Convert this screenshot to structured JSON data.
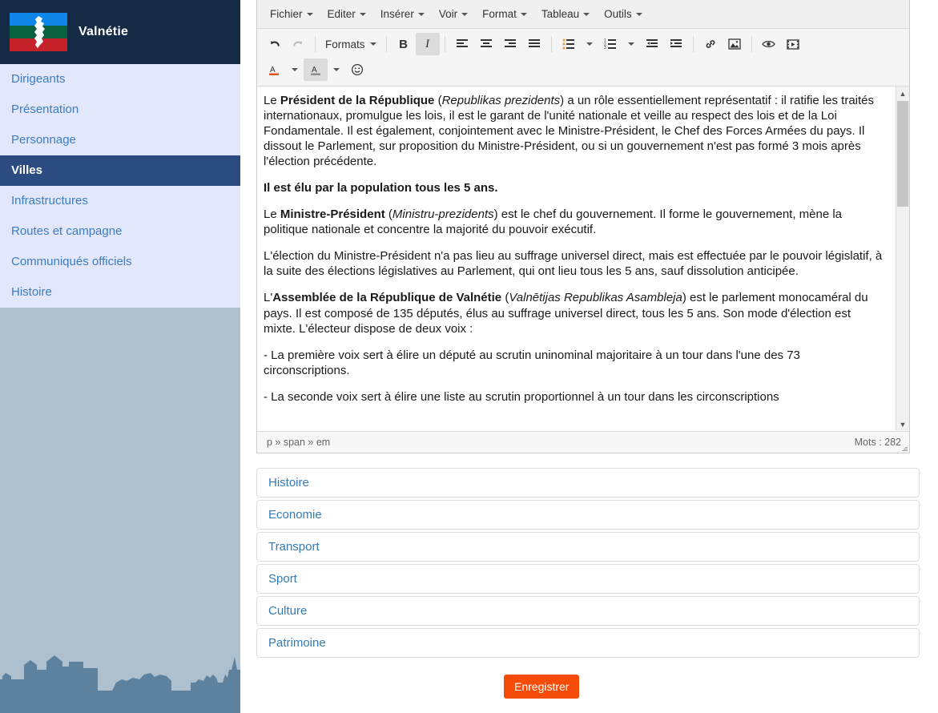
{
  "sidebar": {
    "brand": {
      "title": "Valnétie",
      "logo_icon": "valnetie-flag-icon"
    },
    "items": [
      {
        "label": "Dirigeants",
        "active": false
      },
      {
        "label": "Présentation",
        "active": false
      },
      {
        "label": "Personnage",
        "active": false
      },
      {
        "label": "Villes",
        "active": true
      },
      {
        "label": "Infrastructures",
        "active": false
      },
      {
        "label": "Routes et campagne",
        "active": false
      },
      {
        "label": "Communiqués officiels",
        "active": false
      },
      {
        "label": "Histoire",
        "active": false
      }
    ],
    "footer_graphic": "city-skyline-illustration",
    "colors": {
      "background": "#aec0ce",
      "brand_bg": "#152a45",
      "nav_bg": "#e3e7fb",
      "active_bg": "#2c4c81",
      "link": "#3b7cc4"
    }
  },
  "editor": {
    "menubar": [
      {
        "label": "Fichier"
      },
      {
        "label": "Editer"
      },
      {
        "label": "Insérer"
      },
      {
        "label": "Voir"
      },
      {
        "label": "Format"
      },
      {
        "label": "Tableau"
      },
      {
        "label": "Outils"
      }
    ],
    "toolbar": {
      "undo": "undo-icon",
      "redo": "redo-icon",
      "formats_label": "Formats",
      "bold": "B",
      "italic": "I",
      "align_left": "align-left-icon",
      "align_center": "align-center-icon",
      "align_right": "align-right-icon",
      "align_justify": "align-justify-icon",
      "bullet_list": "bullet-list-icon",
      "numbered_list": "numbered-list-icon",
      "outdent": "outdent-icon",
      "indent": "indent-icon",
      "link": "link-icon",
      "image": "image-icon",
      "preview": "preview-eye-icon",
      "media": "media-icon",
      "text_color": "text-color-icon",
      "background_color": "background-color-icon",
      "emoticon": "emoticon-icon"
    },
    "content": [
      {
        "runs": [
          {
            "t": "Le ",
            "s": ""
          },
          {
            "t": "Président de la République",
            "s": "b"
          },
          {
            "t": " (",
            "s": ""
          },
          {
            "t": "Republikas prezidents",
            "s": "i"
          },
          {
            "t": ") a un rôle essentiellement représentatif : il ratifie les traités internationaux, promulgue les lois, il est le garant de l'unité nationale et veille au respect des lois et de la Loi Fondamentale. Il est également, conjointement avec le Ministre-Président, le Chef des Forces Armées du pays. Il dissout le Parlement, sur proposition du Ministre-Président, ou si un gouvernement n'est pas formé 3 mois après l'élection précédente.",
            "s": ""
          }
        ]
      },
      {
        "runs": [
          {
            "t": "Il est élu par la population tous les 5 ans.",
            "s": "b"
          }
        ]
      },
      {
        "runs": [
          {
            "t": "Le ",
            "s": ""
          },
          {
            "t": "Ministre-Président",
            "s": "b"
          },
          {
            "t": " (",
            "s": ""
          },
          {
            "t": "Ministru-prezidents",
            "s": "i"
          },
          {
            "t": ") est le chef du gouvernement. Il forme le gouvernement, mène la politique nationale et concentre la majorité du pouvoir exécutif.",
            "s": ""
          }
        ]
      },
      {
        "runs": [
          {
            "t": "L'élection du Ministre-Président n'a pas lieu au suffrage universel direct, mais est effectuée par le pouvoir législatif, à la suite des élections législatives au Parlement, qui ont lieu tous les 5 ans, sauf dissolution anticipée.",
            "s": ""
          }
        ]
      },
      {
        "runs": [
          {
            "t": "L'",
            "s": ""
          },
          {
            "t": "Assemblée de la République de Valnétie",
            "s": "b"
          },
          {
            "t": " (",
            "s": ""
          },
          {
            "t": "Valnētijas Republikas Asambleja",
            "s": "i"
          },
          {
            "t": ") est le parlement monocaméral du pays. Il est composé de 135 députés, élus au suffrage universel direct, tous les 5 ans. Son mode d'élection est mixte. L'électeur dispose de deux voix :",
            "s": ""
          }
        ]
      },
      {
        "runs": [
          {
            "t": "- La première voix sert à élire un député au scrutin uninominal majoritaire à un tour dans l'une des 73 circonscriptions.",
            "s": ""
          }
        ]
      },
      {
        "runs": [
          {
            "t": "- La seconde voix sert à élire une liste au scrutin proportionnel à un tour dans les circonscriptions",
            "s": ""
          }
        ]
      }
    ],
    "statusbar": {
      "path": "p » span » em",
      "word_count": "Mots : 282"
    }
  },
  "accordion": {
    "items": [
      {
        "label": "Histoire"
      },
      {
        "label": "Economie"
      },
      {
        "label": "Transport"
      },
      {
        "label": "Sport"
      },
      {
        "label": "Culture"
      },
      {
        "label": "Patrimoine"
      }
    ]
  },
  "actions": {
    "save_label": "Enregistrer",
    "save_color": "#f64c09"
  }
}
